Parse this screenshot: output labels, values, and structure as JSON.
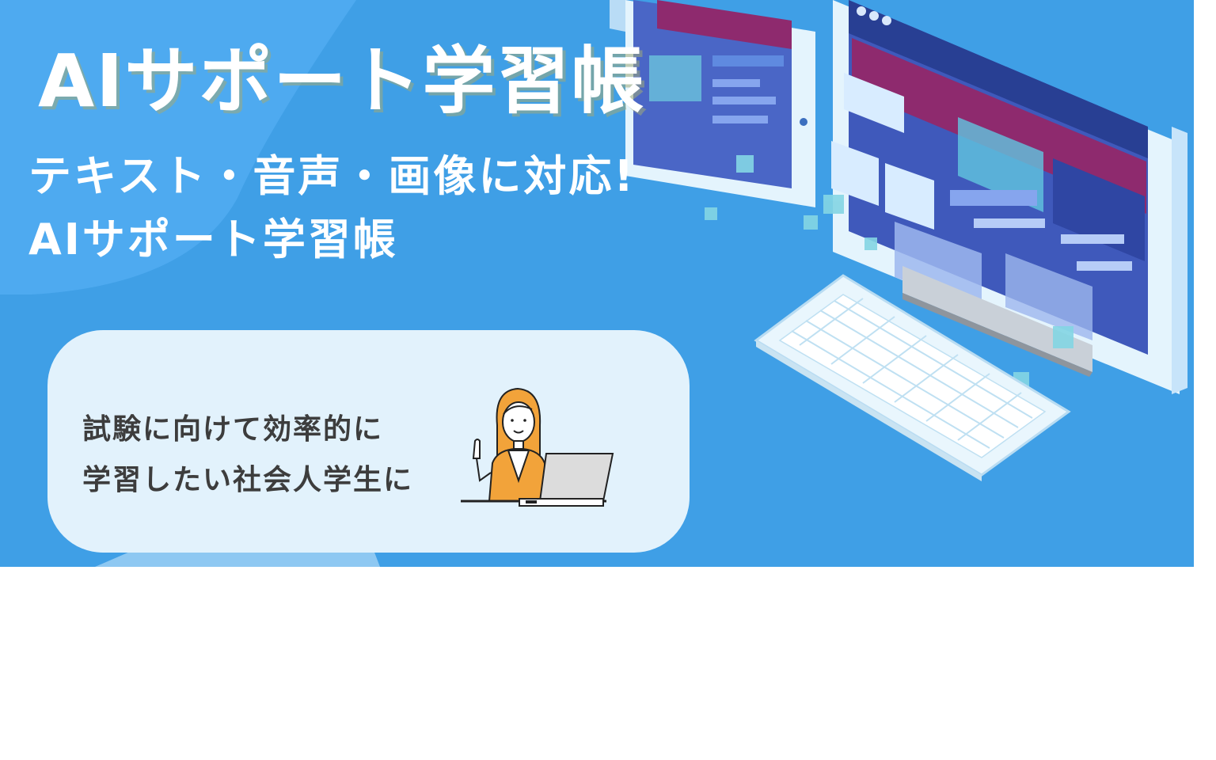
{
  "banner": {
    "title": "AIサポート学習帳",
    "subtitle_line1": "テキスト・音声・画像に対応!",
    "subtitle_line2": "AIサポート学習帳",
    "card": {
      "line1": "試験に向けて効率的に",
      "line2": "学習したい社会人学生に"
    },
    "colors": {
      "background": "#3f9fe6",
      "card": "#e2f2fc",
      "accent_orange": "#f2a33a",
      "screen_magenta": "#8e2a6e"
    },
    "icons": [
      "person-at-laptop-icon",
      "monitor-icon",
      "tablet-icon",
      "keyboard-icon"
    ]
  }
}
